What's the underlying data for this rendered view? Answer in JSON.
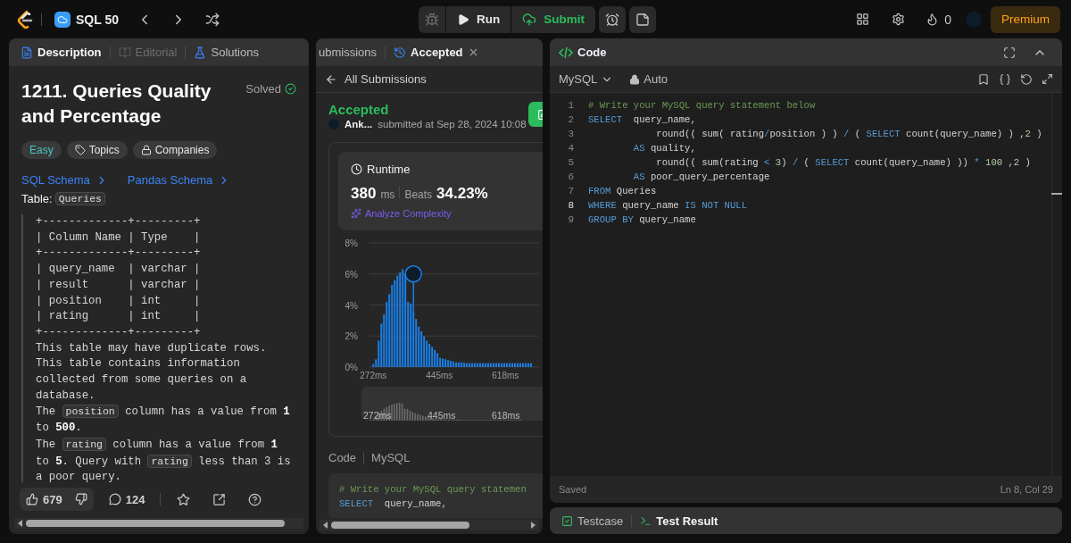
{
  "top_bar": {
    "problem_list": "SQL 50",
    "run": "Run",
    "submit": "Submit",
    "streak": "0",
    "premium": "Premium"
  },
  "description_panel": {
    "tabs": [
      {
        "label": "Description",
        "selected": true,
        "disabled": false
      },
      {
        "label": "Editorial",
        "selected": false,
        "disabled": true
      },
      {
        "label": "Solutions",
        "selected": false,
        "disabled": false
      }
    ],
    "title": "1211. Queries Quality and Percentage",
    "status": "Solved",
    "tags": [
      {
        "label": "Easy",
        "kind": "difficulty"
      },
      {
        "label": "Topics",
        "kind": "topics"
      },
      {
        "label": "Companies",
        "kind": "companies"
      }
    ],
    "schema_links": [
      "SQL Schema",
      "Pandas Schema"
    ],
    "table_label": "Table:",
    "table_name": "Queries",
    "schema_lines": [
      "+-------------+---------+",
      "| Column Name | Type    |",
      "+-------------+---------+",
      "| query_name  | varchar |",
      "| result      | varchar |",
      "| position    | int     |",
      "| rating      | int     |",
      "+-------------+---------+"
    ],
    "paragraphs": [
      [
        {
          "kind": "text",
          "text": "This table may have duplicate rows."
        }
      ],
      [
        {
          "kind": "text",
          "text": "This table contains information collected from some queries on a database."
        }
      ],
      [
        {
          "kind": "text",
          "text": "The "
        },
        {
          "kind": "code",
          "text": "position"
        },
        {
          "kind": "text",
          "text": " column has a value from **1** to **500**."
        }
      ],
      [
        {
          "kind": "text",
          "text": "The "
        },
        {
          "kind": "code",
          "text": "rating"
        },
        {
          "kind": "text",
          "text": " column has a value from **1** to **5**. Query with "
        },
        {
          "kind": "code",
          "text": "rating"
        },
        {
          "kind": "text",
          "text": " less than 3 is a poor query."
        }
      ]
    ],
    "likes": "679",
    "comments": "124"
  },
  "submission_panel": {
    "tabs": [
      {
        "label": "ubmissions",
        "selected": false,
        "closable": false
      },
      {
        "label": "Accepted",
        "selected": true,
        "closable": true
      }
    ],
    "back": "All Submissions",
    "verdict": "Accepted",
    "user": "Ank...",
    "submitted": "submitted at Sep 28, 2024 10:08",
    "runtime": {
      "title": "Runtime",
      "value": "380",
      "unit": "ms",
      "beats_label": "Beats",
      "beats": "34.23%",
      "analyze": "Analyze Complexity"
    },
    "chart_data": {
      "type": "bar",
      "x": [
        272,
        279,
        286,
        293,
        300,
        307,
        314,
        321,
        328,
        335,
        342,
        349,
        356,
        363,
        370,
        377,
        384,
        391,
        398,
        405,
        412,
        419,
        426,
        433,
        440,
        447,
        454,
        461,
        468,
        475,
        482,
        489,
        496,
        503,
        510,
        517,
        524,
        531,
        538,
        545,
        552,
        559,
        566,
        573,
        580,
        587,
        594,
        601,
        608,
        615,
        622,
        629,
        636,
        643,
        650,
        657,
        664,
        671,
        678,
        685
      ],
      "series": [
        {
          "color": "#1a7fe8",
          "values": [
            0.2,
            0.5,
            1.7,
            2.8,
            3.4,
            4.2,
            4.7,
            5.3,
            5.6,
            5.9,
            6.1,
            6.3,
            6.0,
            4.2,
            4.1,
            3.6,
            3.1,
            2.6,
            2.3,
            2.0,
            1.7,
            1.5,
            1.3,
            1.1,
            0.9,
            0.6,
            0.55,
            0.5,
            0.45,
            0.4,
            0.35,
            0.3,
            0.3,
            0.3,
            0.28,
            0.25,
            0.25,
            0.25,
            0.25,
            0.25,
            0.25,
            0.25,
            0.25,
            0.25,
            0.25,
            0.25,
            0.25,
            0.25,
            0.25,
            0.25,
            0.25,
            0.25,
            0.25,
            0.25,
            0.25,
            0.25,
            0.25,
            0.25,
            0.25,
            0.25
          ]
        }
      ],
      "xlim": [
        262,
        705
      ],
      "ylim": [
        0,
        8
      ],
      "grid": true,
      "yticks": [
        {
          "value": 0,
          "label": "0%"
        },
        {
          "value": 2,
          "label": "2%"
        },
        {
          "value": 4,
          "label": "4%"
        },
        {
          "value": 6,
          "label": "6%"
        },
        {
          "value": 8,
          "label": "8%"
        }
      ],
      "xticks": [
        {
          "value": 272,
          "label": "272ms"
        },
        {
          "value": 445,
          "label": "445ms"
        },
        {
          "value": 618,
          "label": "618ms"
        }
      ]
    },
    "navigator_labels": [
      "272ms",
      "445ms",
      "618ms"
    ],
    "code_label": "Code",
    "language": "MySQL",
    "code_lines": [
      [
        {
          "kind": "comment",
          "t": "# Write your MySQL query statemen"
        }
      ],
      [
        {
          "kind": "kw",
          "t": "SELECT"
        },
        {
          "kind": "plain",
          "t": "  query_name,"
        }
      ]
    ]
  },
  "code_panel": {
    "title": "Code",
    "language": "MySQL",
    "mode": "Auto",
    "lines": [
      {
        "number": "1",
        "active": false,
        "tokens": [
          {
            "kind": "comment",
            "t": "# Write your MySQL query statement below"
          }
        ]
      },
      {
        "number": "2",
        "active": false,
        "tokens": [
          {
            "kind": "kw",
            "t": "SELECT"
          },
          {
            "kind": "plain",
            "t": "  query_name,"
          }
        ]
      },
      {
        "number": "3",
        "active": false,
        "tokens": [
          {
            "kind": "plain",
            "t": "            round(( sum( rating"
          },
          {
            "kind": "op",
            "t": "/"
          },
          {
            "kind": "plain",
            "t": "position ) ) "
          },
          {
            "kind": "op",
            "t": "/"
          },
          {
            "kind": "plain",
            "t": " ( "
          },
          {
            "kind": "kw",
            "t": "SELECT"
          },
          {
            "kind": "plain",
            "t": " count(query_name) ) ,"
          },
          {
            "kind": "num",
            "t": "2"
          },
          {
            "kind": "plain",
            "t": " )"
          }
        ]
      },
      {
        "number": "4",
        "active": false,
        "tokens": [
          {
            "kind": "kw",
            "t": "        AS"
          },
          {
            "kind": "plain",
            "t": " quality,"
          }
        ]
      },
      {
        "number": "5",
        "active": false,
        "tokens": [
          {
            "kind": "plain",
            "t": "            round(( sum(rating "
          },
          {
            "kind": "op",
            "t": "< "
          },
          {
            "kind": "num",
            "t": "3"
          },
          {
            "kind": "plain",
            "t": ") "
          },
          {
            "kind": "op",
            "t": "/"
          },
          {
            "kind": "plain",
            "t": " ( "
          },
          {
            "kind": "kw",
            "t": "SELECT"
          },
          {
            "kind": "plain",
            "t": " count(query_name) )) "
          },
          {
            "kind": "op",
            "t": "* "
          },
          {
            "kind": "num",
            "t": "100"
          },
          {
            "kind": "plain",
            "t": " ,"
          },
          {
            "kind": "num",
            "t": "2"
          },
          {
            "kind": "plain",
            "t": " )"
          }
        ]
      },
      {
        "number": "6",
        "active": false,
        "tokens": [
          {
            "kind": "kw",
            "t": "        AS"
          },
          {
            "kind": "plain",
            "t": " poor_query_percentage"
          }
        ]
      },
      {
        "number": "7",
        "active": false,
        "tokens": [
          {
            "kind": "kw",
            "t": "FROM"
          },
          {
            "kind": "plain",
            "t": " Queries"
          }
        ]
      },
      {
        "number": "8",
        "active": true,
        "tokens": [
          {
            "kind": "kw",
            "t": "WHERE"
          },
          {
            "kind": "plain",
            "t": " query_name "
          },
          {
            "kind": "kw",
            "t": "IS NOT NULL"
          }
        ]
      },
      {
        "number": "9",
        "active": false,
        "tokens": [
          {
            "kind": "kw",
            "t": "GROUP BY"
          },
          {
            "kind": "plain",
            "t": " query_name"
          }
        ]
      }
    ],
    "status": "Saved",
    "cursor": "Ln 8, Col 29"
  },
  "result_panel": {
    "tabs": [
      {
        "label": "Testcase",
        "selected": false
      },
      {
        "label": "Test Result",
        "selected": true
      }
    ]
  }
}
